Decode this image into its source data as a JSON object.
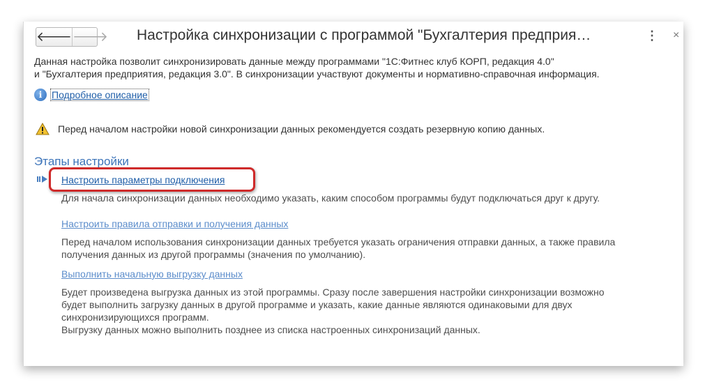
{
  "header": {
    "back_icon": "back-arrow-icon",
    "forward_icon": "forward-arrow-icon",
    "back_glyph": "🡐",
    "forward_glyph": "🡒",
    "title": "Настройка синхронизации с программой \"Бухгалтерия предприя…",
    "more_glyph": "⋮",
    "close_glyph": "×"
  },
  "description": {
    "line1": "Данная настройка позволит синхронизировать данные между программами \"1С:Фитнес клуб КОРП, редакция 4.0\"",
    "line2": "и \"Бухгалтерия предприятия, редакция 3.0\". В синхронизации участвуют документы и нормативно-справочная информация."
  },
  "info": {
    "icon": "info-icon",
    "icon_glyph": "i",
    "link": "Подробное описание"
  },
  "warning": {
    "icon": "warning-icon",
    "text": "Перед началом настройки новой синхронизации данных рекомендуется создать резервную копию данных."
  },
  "stages": {
    "title": "Этапы настройки",
    "items": [
      {
        "label": "Настроить параметры подключения",
        "active": true,
        "lines": [
          "Для начала синхронизации данных необходимо указать, каким способом программы будут подключаться друг к другу."
        ]
      },
      {
        "label": "Настроить правила отправки и получения данных",
        "active": false,
        "lines": [
          "Перед началом использования синхронизации данных требуется указать ограничения отправки данных, а также правила",
          "получения данных из другой программы (значения по умолчанию)."
        ]
      },
      {
        "label": "Выполнить начальную выгрузку данных",
        "active": false,
        "lines": [
          "Будет произведена выгрузка данных из этой программы. Сразу после завершения настройки синхронизации возможно",
          "будет выполнить загрузку данных в другой программе и указать, какие данные являются одинаковыми для двух",
          "синхронизирующихся программ.",
          "Выгрузку данных можно выполнить позднее из списка настроенных синхронизаций данных."
        ]
      }
    ]
  },
  "colors": {
    "highlight": "#cf2a2a",
    "link": "#1f5ea8",
    "section_title": "#3b73b9"
  }
}
